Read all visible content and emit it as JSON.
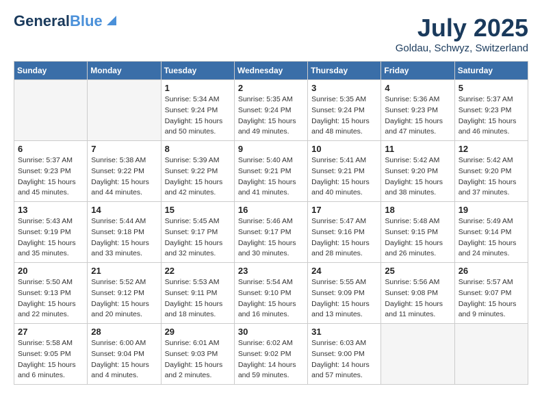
{
  "header": {
    "logo_line1": "General",
    "logo_line2": "Blue",
    "month": "July 2025",
    "location": "Goldau, Schwyz, Switzerland"
  },
  "weekdays": [
    "Sunday",
    "Monday",
    "Tuesday",
    "Wednesday",
    "Thursday",
    "Friday",
    "Saturday"
  ],
  "weeks": [
    [
      {
        "day": "",
        "info": ""
      },
      {
        "day": "",
        "info": ""
      },
      {
        "day": "1",
        "info": "Sunrise: 5:34 AM\nSunset: 9:24 PM\nDaylight: 15 hours\nand 50 minutes."
      },
      {
        "day": "2",
        "info": "Sunrise: 5:35 AM\nSunset: 9:24 PM\nDaylight: 15 hours\nand 49 minutes."
      },
      {
        "day": "3",
        "info": "Sunrise: 5:35 AM\nSunset: 9:24 PM\nDaylight: 15 hours\nand 48 minutes."
      },
      {
        "day": "4",
        "info": "Sunrise: 5:36 AM\nSunset: 9:23 PM\nDaylight: 15 hours\nand 47 minutes."
      },
      {
        "day": "5",
        "info": "Sunrise: 5:37 AM\nSunset: 9:23 PM\nDaylight: 15 hours\nand 46 minutes."
      }
    ],
    [
      {
        "day": "6",
        "info": "Sunrise: 5:37 AM\nSunset: 9:23 PM\nDaylight: 15 hours\nand 45 minutes."
      },
      {
        "day": "7",
        "info": "Sunrise: 5:38 AM\nSunset: 9:22 PM\nDaylight: 15 hours\nand 44 minutes."
      },
      {
        "day": "8",
        "info": "Sunrise: 5:39 AM\nSunset: 9:22 PM\nDaylight: 15 hours\nand 42 minutes."
      },
      {
        "day": "9",
        "info": "Sunrise: 5:40 AM\nSunset: 9:21 PM\nDaylight: 15 hours\nand 41 minutes."
      },
      {
        "day": "10",
        "info": "Sunrise: 5:41 AM\nSunset: 9:21 PM\nDaylight: 15 hours\nand 40 minutes."
      },
      {
        "day": "11",
        "info": "Sunrise: 5:42 AM\nSunset: 9:20 PM\nDaylight: 15 hours\nand 38 minutes."
      },
      {
        "day": "12",
        "info": "Sunrise: 5:42 AM\nSunset: 9:20 PM\nDaylight: 15 hours\nand 37 minutes."
      }
    ],
    [
      {
        "day": "13",
        "info": "Sunrise: 5:43 AM\nSunset: 9:19 PM\nDaylight: 15 hours\nand 35 minutes."
      },
      {
        "day": "14",
        "info": "Sunrise: 5:44 AM\nSunset: 9:18 PM\nDaylight: 15 hours\nand 33 minutes."
      },
      {
        "day": "15",
        "info": "Sunrise: 5:45 AM\nSunset: 9:17 PM\nDaylight: 15 hours\nand 32 minutes."
      },
      {
        "day": "16",
        "info": "Sunrise: 5:46 AM\nSunset: 9:17 PM\nDaylight: 15 hours\nand 30 minutes."
      },
      {
        "day": "17",
        "info": "Sunrise: 5:47 AM\nSunset: 9:16 PM\nDaylight: 15 hours\nand 28 minutes."
      },
      {
        "day": "18",
        "info": "Sunrise: 5:48 AM\nSunset: 9:15 PM\nDaylight: 15 hours\nand 26 minutes."
      },
      {
        "day": "19",
        "info": "Sunrise: 5:49 AM\nSunset: 9:14 PM\nDaylight: 15 hours\nand 24 minutes."
      }
    ],
    [
      {
        "day": "20",
        "info": "Sunrise: 5:50 AM\nSunset: 9:13 PM\nDaylight: 15 hours\nand 22 minutes."
      },
      {
        "day": "21",
        "info": "Sunrise: 5:52 AM\nSunset: 9:12 PM\nDaylight: 15 hours\nand 20 minutes."
      },
      {
        "day": "22",
        "info": "Sunrise: 5:53 AM\nSunset: 9:11 PM\nDaylight: 15 hours\nand 18 minutes."
      },
      {
        "day": "23",
        "info": "Sunrise: 5:54 AM\nSunset: 9:10 PM\nDaylight: 15 hours\nand 16 minutes."
      },
      {
        "day": "24",
        "info": "Sunrise: 5:55 AM\nSunset: 9:09 PM\nDaylight: 15 hours\nand 13 minutes."
      },
      {
        "day": "25",
        "info": "Sunrise: 5:56 AM\nSunset: 9:08 PM\nDaylight: 15 hours\nand 11 minutes."
      },
      {
        "day": "26",
        "info": "Sunrise: 5:57 AM\nSunset: 9:07 PM\nDaylight: 15 hours\nand 9 minutes."
      }
    ],
    [
      {
        "day": "27",
        "info": "Sunrise: 5:58 AM\nSunset: 9:05 PM\nDaylight: 15 hours\nand 6 minutes."
      },
      {
        "day": "28",
        "info": "Sunrise: 6:00 AM\nSunset: 9:04 PM\nDaylight: 15 hours\nand 4 minutes."
      },
      {
        "day": "29",
        "info": "Sunrise: 6:01 AM\nSunset: 9:03 PM\nDaylight: 15 hours\nand 2 minutes."
      },
      {
        "day": "30",
        "info": "Sunrise: 6:02 AM\nSunset: 9:02 PM\nDaylight: 14 hours\nand 59 minutes."
      },
      {
        "day": "31",
        "info": "Sunrise: 6:03 AM\nSunset: 9:00 PM\nDaylight: 14 hours\nand 57 minutes."
      },
      {
        "day": "",
        "info": ""
      },
      {
        "day": "",
        "info": ""
      }
    ]
  ]
}
